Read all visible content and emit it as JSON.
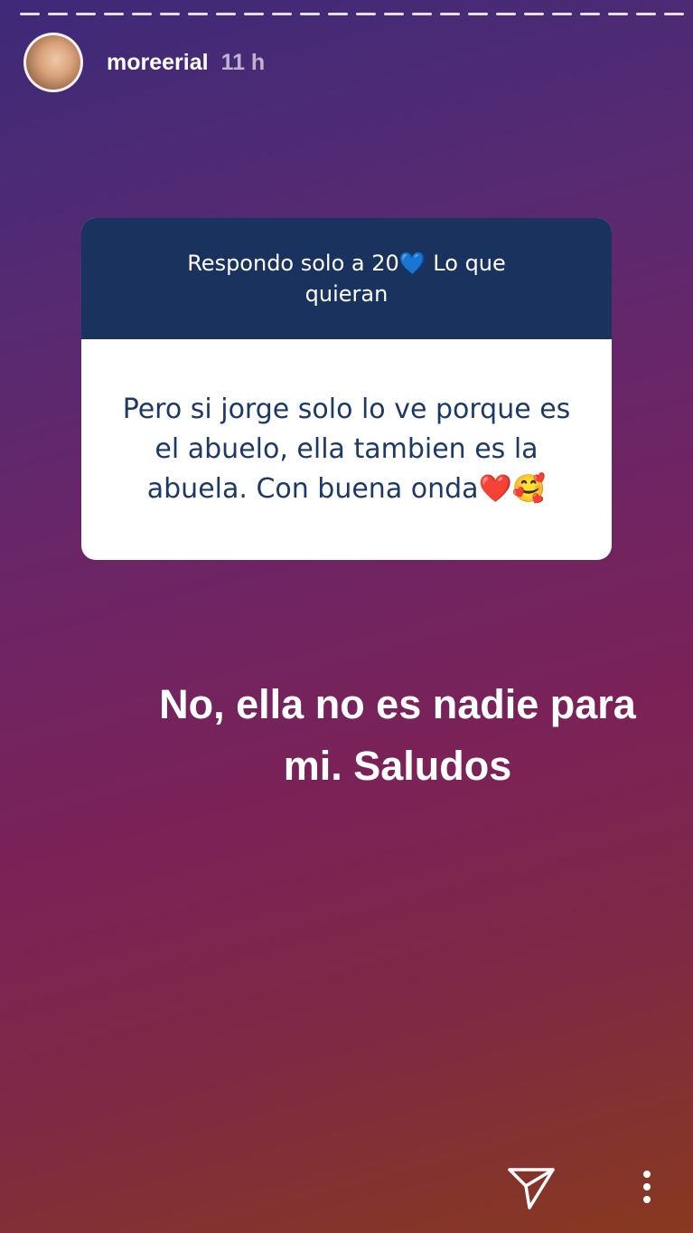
{
  "story": {
    "username": "moreerial",
    "time": "11 h"
  },
  "question": {
    "prompt": "Respondo solo a 20💙 Lo que quieran",
    "answer": "Pero si jorge solo lo ve porque es el abuelo, ella tambien es la abuela. Con buena onda❤️🥰"
  },
  "reply_text": "No, ella no es nadie para mi. Saludos",
  "icons": {
    "share": "send-icon",
    "more": "more-vertical-icon",
    "avatar": "avatar"
  }
}
